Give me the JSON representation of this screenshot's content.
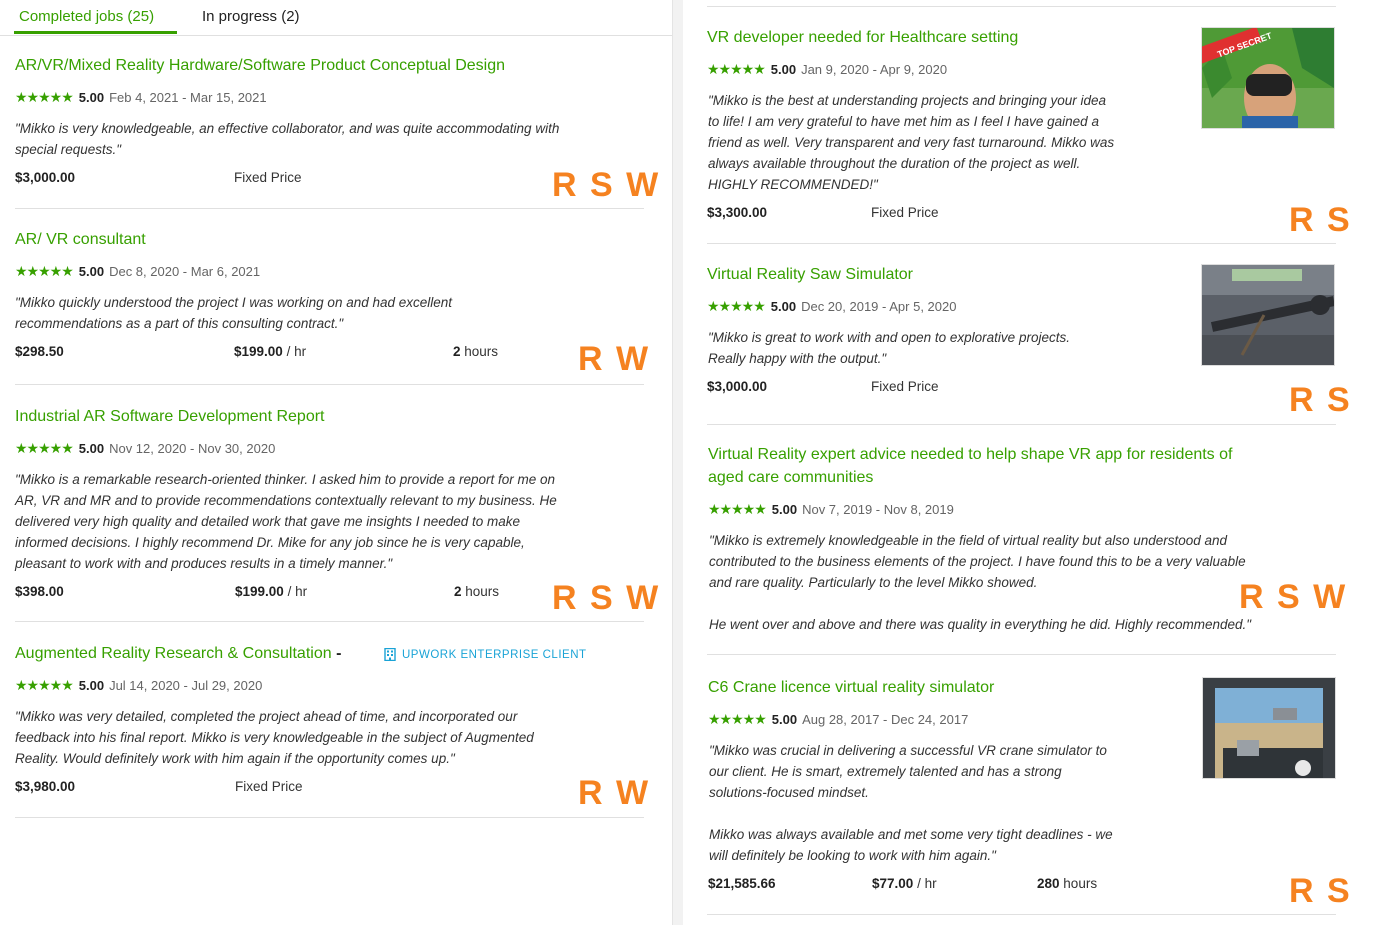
{
  "tabs": {
    "completed": "Completed jobs (25)",
    "in_progress": "In progress (2)"
  },
  "colors": {
    "accent": "#37a000",
    "tag": "#f58220",
    "enterprise": "#1aa3d6"
  },
  "left_jobs": [
    {
      "title": "AR/VR/Mixed Reality Hardware/Software Product Conceptual Design",
      "stars": "★★★★★",
      "rating": "5.00",
      "dates": "Feb 4, 2021 - Mar 15, 2021",
      "quote_lines": [
        "\"Mikko is very knowledgeable, an effective collaborator, and was quite accommodating with",
        "special requests.\""
      ],
      "amount": "$3,000.00",
      "price_type": "Fixed Price",
      "tags": "R S W"
    },
    {
      "title": "AR/ VR consultant",
      "stars": "★★★★★",
      "rating": "5.00",
      "dates": "Dec 8, 2020 - Mar 6, 2021",
      "quote_lines": [
        "\"Mikko quickly understood the project I was working on and had excellent",
        "recommendations as a part of this consulting contract.\""
      ],
      "amount": "$298.50",
      "rate": "$199.00",
      "rate_unit": "/ hr",
      "hours": "2",
      "hours_unit": "hours",
      "tags": "R W"
    },
    {
      "title": "Industrial AR Software Development Report",
      "stars": "★★★★★",
      "rating": "5.00",
      "dates": "Nov 12, 2020 - Nov 30, 2020",
      "quote_lines": [
        "\"Mikko is a remarkable research-oriented thinker. I asked him to provide a report for me on",
        "AR, VR and MR and to provide recommendations contextually relevant to my business. He",
        "delivered very high quality and detailed work that gave me insights I needed to make",
        "informed decisions. I highly recommend Dr. Mike for any job since he is very capable,",
        "pleasant to work with and produces results in a timely manner.\""
      ],
      "amount": "$398.00",
      "rate": "$199.00",
      "rate_unit": "/ hr",
      "hours": "2",
      "hours_unit": "hours",
      "tags": "R S W"
    },
    {
      "title": "Augmented Reality Research & Consultation",
      "title_dash": "-",
      "enterprise_label": "UPWORK ENTERPRISE CLIENT",
      "enterprise_icon": "building-icon",
      "stars": "★★★★★",
      "rating": "5.00",
      "dates": "Jul 14, 2020 - Jul 29, 2020",
      "quote_lines": [
        "\"Mikko was very detailed, completed the project ahead of time, and incorporated our",
        "feedback into his final report. Mikko is very knowledgeable in the subject of Augmented",
        "Reality. Would definitely work with him again if the opportunity comes up.\""
      ],
      "amount": "$3,980.00",
      "price_type": "Fixed Price",
      "tags": "R W"
    }
  ],
  "right_jobs": [
    {
      "title": "VR developer needed for Healthcare setting",
      "stars": "★★★★★",
      "rating": "5.00",
      "dates": "Jan 9, 2020 - Apr 9, 2020",
      "quote_lines": [
        "\"Mikko is the best at understanding projects and bringing your idea",
        "to life! I am very grateful to have met him as I feel I have gained a",
        "friend as well. Very transparent and very fast turnaround. Mikko was",
        "always available throughout the duration of the project as well.",
        "HIGHLY RECOMMENDED!\""
      ],
      "amount": "$3,300.00",
      "price_type": "Fixed Price",
      "tags": "R S",
      "thumb_label": "TOP SECRET"
    },
    {
      "title": "Virtual Reality Saw Simulator",
      "stars": "★★★★★",
      "rating": "5.00",
      "dates": "Dec 20, 2019 - Apr 5, 2020",
      "quote_lines": [
        "\"Mikko is great to work with and open to explorative projects.",
        "Really happy with the output.\""
      ],
      "amount": "$3,000.00",
      "price_type": "Fixed Price",
      "tags": "R S"
    },
    {
      "title_lines": [
        "Virtual Reality expert advice needed to help shape VR app for residents of",
        "aged care communities"
      ],
      "stars": "★★★★★",
      "rating": "5.00",
      "dates": "Nov 7, 2019 - Nov 8, 2019",
      "quote_lines": [
        "\"Mikko is extremely knowledgeable in the field of virtual reality but also understood and",
        "contributed to the business elements of the project. I have found this to be a very valuable",
        "and rare quality. Particularly to the level Mikko showed."
      ],
      "quote_tail": "He went over and above and there was quality in everything he did. Highly recommended.\"",
      "tags": "R S W"
    },
    {
      "title": "C6 Crane licence virtual reality simulator",
      "stars": "★★★★★",
      "rating": "5.00",
      "dates": "Aug 28, 2017 - Dec 24, 2017",
      "quote_lines": [
        "\"Mikko was crucial in delivering a successful VR crane simulator to",
        "our client. He is smart, extremely talented and has a strong",
        "solutions-focused mindset."
      ],
      "quote_tail_lines": [
        "Mikko was always available and met some very tight deadlines - we",
        "will definitely be looking to work with him again.\""
      ],
      "amount": "$21,585.66",
      "rate": "$77.00",
      "rate_unit": "/ hr",
      "hours": "280",
      "hours_unit": "hours",
      "tags": "R S"
    }
  ]
}
